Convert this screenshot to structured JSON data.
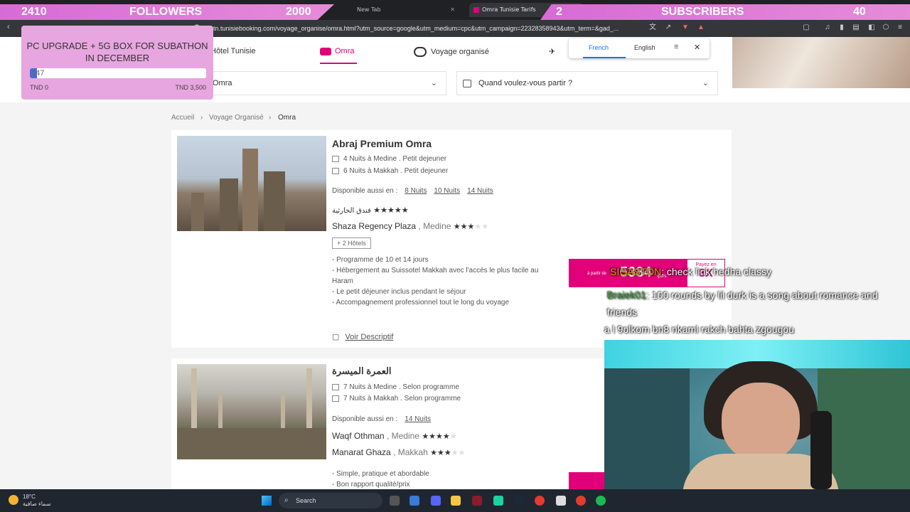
{
  "browser": {
    "tabs": [
      {
        "title": "New Tab"
      },
      {
        "title": "Omra Tunisie Tarifs"
      }
    ],
    "url": "tn.tunisiebooking.com/voyage_organise/omra.html?utm_source=google&utm_medium=cpc&utm_campaign=22328358943&utm_term=&gad_..."
  },
  "overlay": {
    "followers_current": "2410",
    "followers_label": "FOLLOWERS",
    "followers_goal": "2000",
    "subs_current": "2",
    "subs_label": "SUBSCRIBERS",
    "subs_goal": "40",
    "goal_title": "PC UPGRADE + 5G BOX FOR SUBATHON IN DECEMBER",
    "goal_value": "147",
    "goal_progress": 0.042,
    "goal_min": "TND 0",
    "goal_max": "TND 3,500"
  },
  "site": {
    "nav": [
      {
        "label": "Hôtel Tunisie"
      },
      {
        "label": "Omra"
      },
      {
        "label": "Voyage organisé"
      }
    ],
    "destination_value": "Omra",
    "date_placeholder": "Quand voulez-vous partir ?",
    "breadcrumb": [
      "Accueil",
      "Voyage Organisé",
      "Omra"
    ],
    "translate": {
      "from": "French",
      "to": "English"
    }
  },
  "cards": [
    {
      "title": "Abraj Premium Omra",
      "features": [
        {
          "nights": "4",
          "label": "Nuits à",
          "city": "Medine",
          "meal": "Petit dejeuner"
        },
        {
          "nights": "6",
          "label": "Nuits à",
          "city": "Makkah",
          "meal": "Petit dejeuner"
        }
      ],
      "avail_label": "Disponible aussi en :",
      "avail": [
        "8 Nuits",
        "10 Nuits",
        "14 Nuits"
      ],
      "hotels": [
        {
          "name": "فندق الحارثية",
          "city": "",
          "stars": 5
        },
        {
          "name": "Shaza Regency Plaza",
          "city": ", Medine",
          "stars": 3
        }
      ],
      "more_hotels": "+ 2 Hôtels",
      "description": [
        "- Programme de 10 et 14 jours",
        "- Hébergement au Suissotel Makkah avec l'accès le plus facile au Haram",
        "- Le petit déjeuner inclus pendant le séjour",
        "- Accompagnement professionnel tout le long du voyage"
      ],
      "details_link": "Voir Descriptif",
      "price_small": "à partir de",
      "price": "5384",
      "price_unit": "/pers",
      "pay_label": "Payez en",
      "pay_times": "8X"
    },
    {
      "title": "العمرة الميسرة",
      "features": [
        {
          "nights": "7",
          "label": "Nuits à",
          "city": "Medine",
          "meal": "Selon programme"
        },
        {
          "nights": "7",
          "label": "Nuits à",
          "city": "Makkah",
          "meal": "Selon programme"
        }
      ],
      "avail_label": "Disponible aussi en :",
      "avail": [
        "14 Nuits"
      ],
      "hotels": [
        {
          "name": "Waqf Othman",
          "city": ", Medine",
          "stars": 4
        },
        {
          "name": "Manarat Ghaza",
          "city": ", Makkah",
          "stars": 3
        }
      ],
      "description": [
        "- Simple, pratique et abordable",
        "- Bon rapport qualité/prix"
      ]
    }
  ],
  "chat": [
    {
      "user": "SIGASTON",
      "message": ": check link hedha classy"
    },
    {
      "user": "Braiek01",
      "message": ": 100 rounds by lil durk is a song about romance and friends"
    },
    {
      "user": "",
      "message": "a l 9olkom bn8 nkaml rakch bahta zgougou"
    }
  ],
  "taskbar": {
    "temperature": "18°C",
    "weather": "سماء صافية",
    "search_label": "Search"
  },
  "colors": {
    "brand": "#e2007a",
    "overlay": "#d76bd6"
  }
}
